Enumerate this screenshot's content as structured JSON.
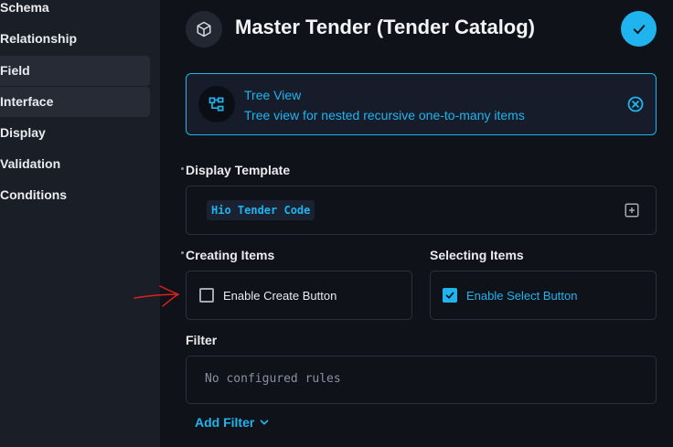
{
  "sidebar": {
    "items": [
      {
        "label": "Schema"
      },
      {
        "label": "Relationship"
      },
      {
        "label": "Field"
      },
      {
        "label": "Interface"
      },
      {
        "label": "Display"
      },
      {
        "label": "Validation"
      },
      {
        "label": "Conditions"
      }
    ]
  },
  "header": {
    "title": "Master Tender (Tender Catalog)",
    "icon": "cube-icon",
    "save_icon": "check-icon"
  },
  "interface": {
    "name": "Tree View",
    "description": "Tree view for nested recursive one-to-many items",
    "icon": "tree-view-icon"
  },
  "display_template": {
    "label": "Display Template",
    "value": "Hio Tender Code"
  },
  "creating_items": {
    "label": "Creating Items",
    "checkbox_label": "Enable Create Button",
    "checked": false
  },
  "selecting_items": {
    "label": "Selecting Items",
    "checkbox_label": "Enable Select Button",
    "checked": true
  },
  "filter": {
    "label": "Filter",
    "empty_text": "No configured rules",
    "add_label": "Add Filter"
  },
  "colors": {
    "accent": "#1fb4ee",
    "background": "#0f1219",
    "sidebar": "#1a1e27",
    "annotation": "#e0201f"
  }
}
